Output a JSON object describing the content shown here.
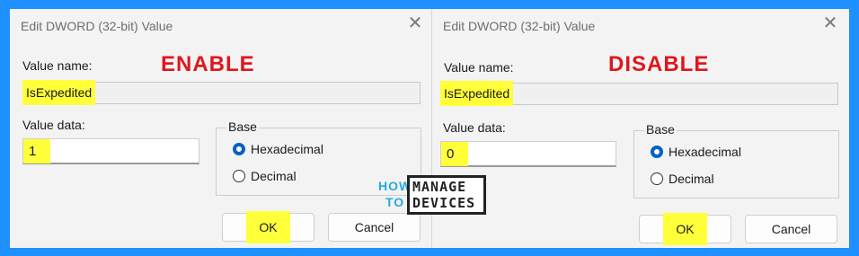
{
  "left": {
    "title": "Edit DWORD (32-bit) Value",
    "banner": "ENABLE",
    "value_name_label": "Value name:",
    "value_name": "IsExpedited",
    "value_data_label": "Value data:",
    "value_data": "1",
    "base_label": "Base",
    "radio_hex": "Hexadecimal",
    "radio_dec": "Decimal",
    "selected_base": "Hexadecimal",
    "ok": "OK",
    "cancel": "Cancel",
    "close_icon": "close-icon"
  },
  "right": {
    "title": "Edit DWORD (32-bit) Value",
    "banner": "DISABLE",
    "value_name_label": "Value name:",
    "value_name": "IsExpedited",
    "value_data_label": "Value data:",
    "value_data": "0",
    "base_label": "Base",
    "radio_hex": "Hexadecimal",
    "radio_dec": "Decimal",
    "selected_base": "Hexadecimal",
    "ok": "OK",
    "cancel": "Cancel",
    "close_icon": "close-icon"
  },
  "logo": {
    "how": "HOW",
    "to": "TO",
    "manage": "MANAGE",
    "devices": "DEVICES"
  },
  "colors": {
    "background": "#1e90ff",
    "highlight": "#ffff3a",
    "banner": "#e0161b",
    "radio_selected": "#0062c4"
  }
}
